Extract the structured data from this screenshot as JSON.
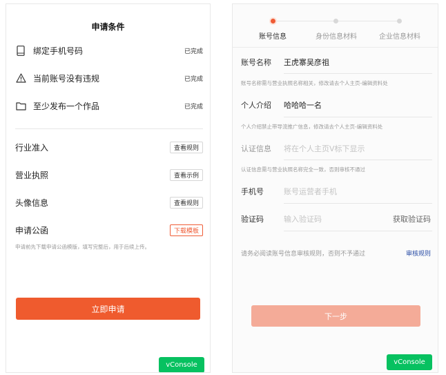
{
  "left": {
    "title": "申请条件",
    "conditions": [
      {
        "icon": "phone-icon",
        "label": "绑定手机号码",
        "status": "已完成"
      },
      {
        "icon": "warning-icon",
        "label": "当前账号没有违规",
        "status": "已完成"
      },
      {
        "icon": "folder-icon",
        "label": "至少发布一个作品",
        "status": "已完成"
      }
    ],
    "rows": [
      {
        "label": "行业准入",
        "button": "查看规则"
      },
      {
        "label": "营业执照",
        "button": "查看示例"
      },
      {
        "label": "头像信息",
        "button": "查看规则"
      },
      {
        "label": "申请公函",
        "button": "下载模板"
      }
    ],
    "note": "申请前先下载申请公函模版，填写完整后，用于后续上传。",
    "apply_label": "立即申请",
    "vconsole_label": "vConsole"
  },
  "right": {
    "steps": [
      {
        "label": "账号信息",
        "active": true
      },
      {
        "label": "身份信息材料",
        "active": false
      },
      {
        "label": "企业信息材料",
        "active": false
      }
    ],
    "fields": {
      "account_name": {
        "label": "账号名称",
        "value": "王虎寨吴彦祖"
      },
      "account_name_hint": "账号名称需与营业执照名称相关，修改请去个人主页-编辑资料处",
      "intro": {
        "label": "个人介绍",
        "value": "哈哈哈一名"
      },
      "intro_hint": "个人介绍禁止带导流推广信息，修改请去个人主页-编辑资料处",
      "cert": {
        "label": "认证信息",
        "placeholder": "将在个人主页V标下显示"
      },
      "cert_hint": "认证信息需与营业执照名称完全一致，否则审核不通过",
      "phone": {
        "label": "手机号",
        "placeholder": "账号运营者手机"
      },
      "code": {
        "label": "验证码",
        "placeholder": "输入验证码",
        "get_code": "获取验证码"
      }
    },
    "rule_text": "请务必阅读账号信息审核规则，否则不予通过",
    "rule_link": "审核规则",
    "next_label": "下一步",
    "vconsole_label": "vConsole"
  },
  "colors": {
    "accent": "#ef5b2e",
    "next_disabled": "#f4ab98",
    "vconsole": "#07c160",
    "link": "#2b4ea6"
  }
}
